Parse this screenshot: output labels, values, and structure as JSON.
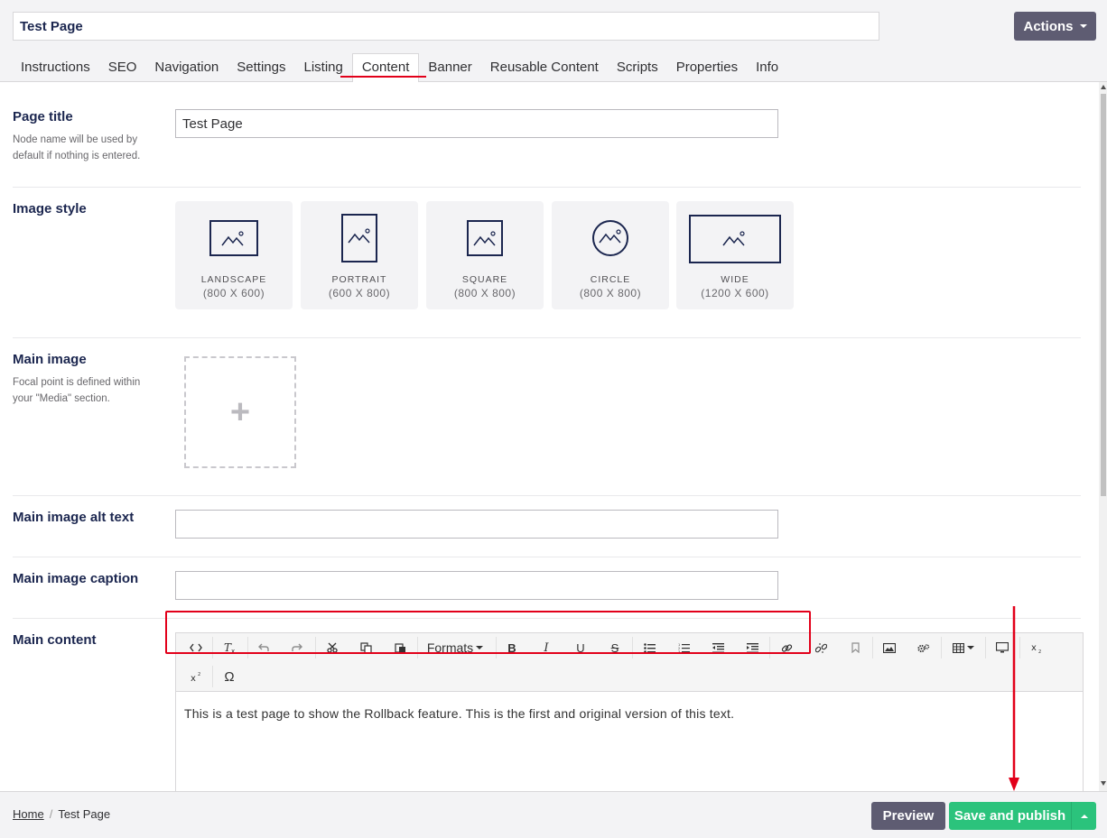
{
  "header": {
    "node_name": "Test Page",
    "actions_label": "Actions"
  },
  "tabs": [
    "Instructions",
    "SEO",
    "Navigation",
    "Settings",
    "Listing",
    "Content",
    "Banner",
    "Reusable Content",
    "Scripts",
    "Properties",
    "Info"
  ],
  "active_tab": "Content",
  "properties": {
    "page_title": {
      "label": "Page title",
      "description": "Node name will be used by default if nothing is entered.",
      "value": "Test Page"
    },
    "image_style": {
      "label": "Image style",
      "options": [
        {
          "name": "LANDSCAPE",
          "size": "(800 X 600)",
          "icon": "landscape-icon"
        },
        {
          "name": "PORTRAIT",
          "size": "(600 X 800)",
          "icon": "portrait-icon"
        },
        {
          "name": "SQUARE",
          "size": "(800 X 800)",
          "icon": "square-icon"
        },
        {
          "name": "CIRCLE",
          "size": "(800 X 800)",
          "icon": "circle-icon"
        },
        {
          "name": "WIDE",
          "size": "(1200 X 600)",
          "icon": "wide-icon"
        }
      ]
    },
    "main_image": {
      "label": "Main image",
      "description": "Focal point is defined within your \"Media\" section.",
      "placeholder_icon": "plus-icon"
    },
    "main_image_alt": {
      "label": "Main image alt text",
      "value": ""
    },
    "main_image_caption": {
      "label": "Main image caption",
      "value": ""
    },
    "main_content": {
      "label": "Main content",
      "formats_label": "Formats",
      "body_text": "This is a test page to show the Rollback feature. This is the first and original version of this text."
    }
  },
  "footer": {
    "breadcrumb": [
      "Home",
      "Test Page"
    ],
    "preview_label": "Preview",
    "save_label": "Save and publish"
  },
  "colors": {
    "accent_red": "#e2001a",
    "save_green": "#2bc37c",
    "button_purple": "#5e5c72"
  }
}
